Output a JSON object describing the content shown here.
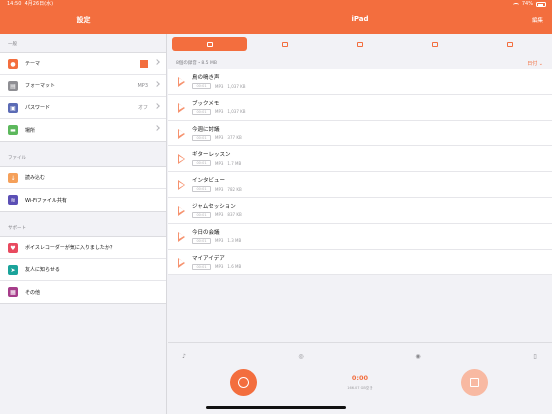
{
  "status": {
    "time": "14:50",
    "date": "4月26日(水)",
    "battery": "74%"
  },
  "nav": {
    "left_title": "設定",
    "center_title": "iPad",
    "edit": "編集"
  },
  "colors": {
    "accent": "#f36e3e"
  },
  "sidebar": {
    "sections": [
      {
        "header": "一般",
        "items": [
          {
            "label": "テーマ",
            "value": "",
            "icon": "palette-icon",
            "color": "#f36e3e"
          },
          {
            "label": "フォーマット",
            "value": "MP3",
            "icon": "document-icon",
            "color": "#8e8e93"
          },
          {
            "label": "パスワード",
            "value": "オフ",
            "icon": "lock-icon",
            "color": "#5b6bb5"
          },
          {
            "label": "場所",
            "value": "",
            "icon": "folder-icon",
            "color": "#5cb85c"
          }
        ]
      },
      {
        "header": "ファイル",
        "items": [
          {
            "label": "読み込む",
            "value": "",
            "icon": "download-icon",
            "color": "#f5a05a"
          },
          {
            "label": "Wi-Fiファイル共有",
            "value": "",
            "icon": "wifi-icon",
            "color": "#5b4fb5"
          }
        ]
      },
      {
        "header": "サポート",
        "items": [
          {
            "label": "ボイスレコーダーが気に入りましたか？",
            "value": "",
            "icon": "heart-icon",
            "color": "#e84a5f"
          },
          {
            "label": "友人に知らせる",
            "value": "",
            "icon": "share-icon",
            "color": "#1aa39a"
          },
          {
            "label": "その他",
            "value": "",
            "icon": "grid-icon",
            "color": "#a63d8a"
          }
        ]
      }
    ]
  },
  "main": {
    "tabs": [
      "microphone-icon",
      "alarm-icon",
      "list-icon",
      "calendar-icon",
      "trash-icon"
    ],
    "list_info": "8個の録音・8.5 MB",
    "sort_label": "日付",
    "recordings": [
      {
        "title": "鳥の鳴き声",
        "duration": "00:01",
        "format": "MP3",
        "size": "1,037 KB"
      },
      {
        "title": "ブックメモ",
        "duration": "00:01",
        "format": "MP3",
        "size": "1,037 KB"
      },
      {
        "title": "今週に討議",
        "duration": "00:01",
        "format": "MP3",
        "size": "377 KB"
      },
      {
        "title": "ギターレッスン",
        "duration": "00:01",
        "format": "MP3",
        "size": "1.7 MB"
      },
      {
        "title": "インタビュー",
        "duration": "00:01",
        "format": "MP3",
        "size": "782 KB"
      },
      {
        "title": "ジャムセッション",
        "duration": "00:01",
        "format": "MP3",
        "size": "837 KB"
      },
      {
        "title": "今日の会議",
        "duration": "00:01",
        "format": "MP3",
        "size": "1.3 MB"
      },
      {
        "title": "マイアイデア",
        "duration": "00:01",
        "format": "MP3",
        "size": "1.6 MB"
      }
    ]
  },
  "player": {
    "timer": "0:00",
    "free_space": "166.07 GB空き"
  }
}
